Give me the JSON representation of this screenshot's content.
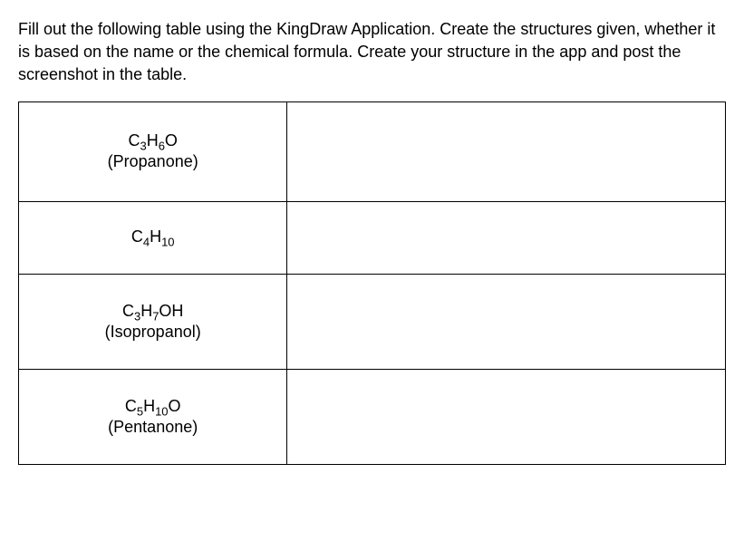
{
  "instructions": "Fill out the following table using the KingDraw Application. Create the structures given, whether it is based on the name or the chemical formula. Create your structure in the app and post the screenshot in the table.",
  "rows": [
    {
      "formula_parts": [
        "C",
        "3",
        "H",
        "6",
        "O"
      ],
      "name": "(Propanone)"
    },
    {
      "formula_parts": [
        "C",
        "4",
        "H",
        "10"
      ],
      "name": ""
    },
    {
      "formula_parts": [
        "C",
        "3",
        "H",
        "7",
        "OH"
      ],
      "name": "(Isopropanol)"
    },
    {
      "formula_parts": [
        "C",
        "5",
        "H",
        "10",
        "O"
      ],
      "name": "(Pentanone)"
    }
  ]
}
